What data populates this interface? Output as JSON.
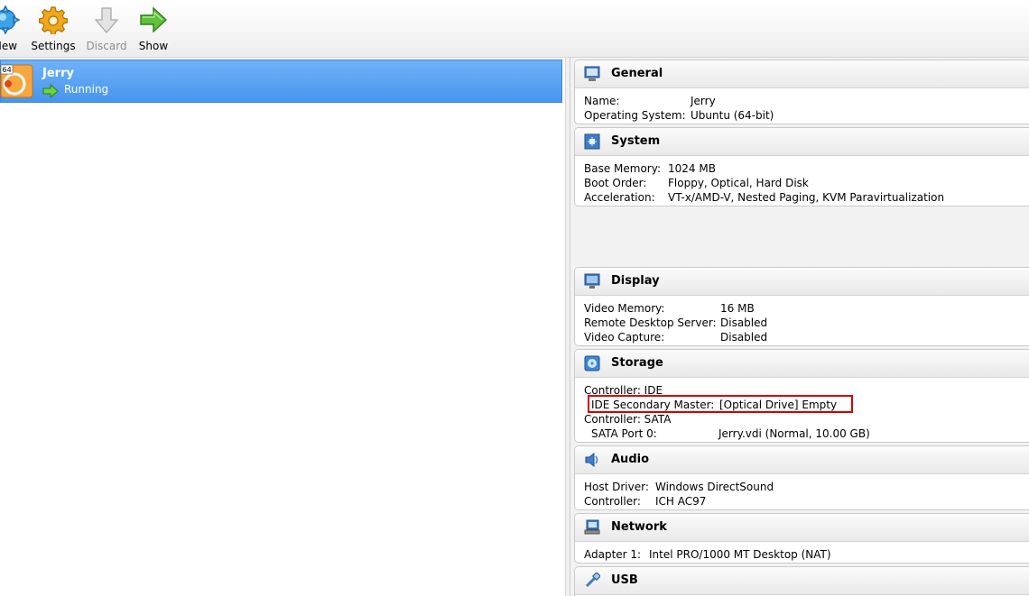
{
  "toolbar": {
    "new_label": "New",
    "settings_label": "Settings",
    "discard_label": "Discard",
    "show_label": "Show"
  },
  "vm_list": {
    "items": [
      {
        "name": "Jerry",
        "state": "Running",
        "os_badge": "64"
      }
    ]
  },
  "details": {
    "general": {
      "title": "General",
      "rows": [
        {
          "label": "Name:",
          "value": "Jerry"
        },
        {
          "label": "Operating System:",
          "value": "Ubuntu (64-bit)"
        }
      ]
    },
    "system": {
      "title": "System",
      "rows": [
        {
          "label": "Base Memory:",
          "value": "1024 MB"
        },
        {
          "label": "Boot Order:",
          "value": "Floppy, Optical, Hard Disk"
        },
        {
          "label": "Acceleration:",
          "value": "VT-x/AMD-V, Nested Paging, KVM Paravirtualization"
        }
      ]
    },
    "display": {
      "title": "Display",
      "rows": [
        {
          "label": "Video Memory:",
          "value": "16 MB"
        },
        {
          "label": "Remote Desktop Server:",
          "value": "Disabled"
        },
        {
          "label": "Video Capture:",
          "value": "Disabled"
        }
      ]
    },
    "storage": {
      "title": "Storage",
      "rows": [
        {
          "label": "Controller: IDE",
          "value": ""
        },
        {
          "label": "IDE Secondary Master:",
          "value": "[Optical Drive] Empty"
        },
        {
          "label": "Controller: SATA",
          "value": ""
        },
        {
          "label": "SATA Port 0:",
          "value": "Jerry.vdi (Normal, 10.00 GB)"
        }
      ]
    },
    "audio": {
      "title": "Audio",
      "rows": [
        {
          "label": "Host Driver:",
          "value": "Windows DirectSound"
        },
        {
          "label": "Controller:",
          "value": "ICH AC97"
        }
      ]
    },
    "network": {
      "title": "Network",
      "rows": [
        {
          "label": "Adapter 1:",
          "value": "Intel PRO/1000 MT Desktop (NAT)"
        }
      ]
    },
    "usb": {
      "title": "USB"
    }
  },
  "colors": {
    "selection": "#4f9cf0",
    "highlight_box": "#d40000"
  }
}
